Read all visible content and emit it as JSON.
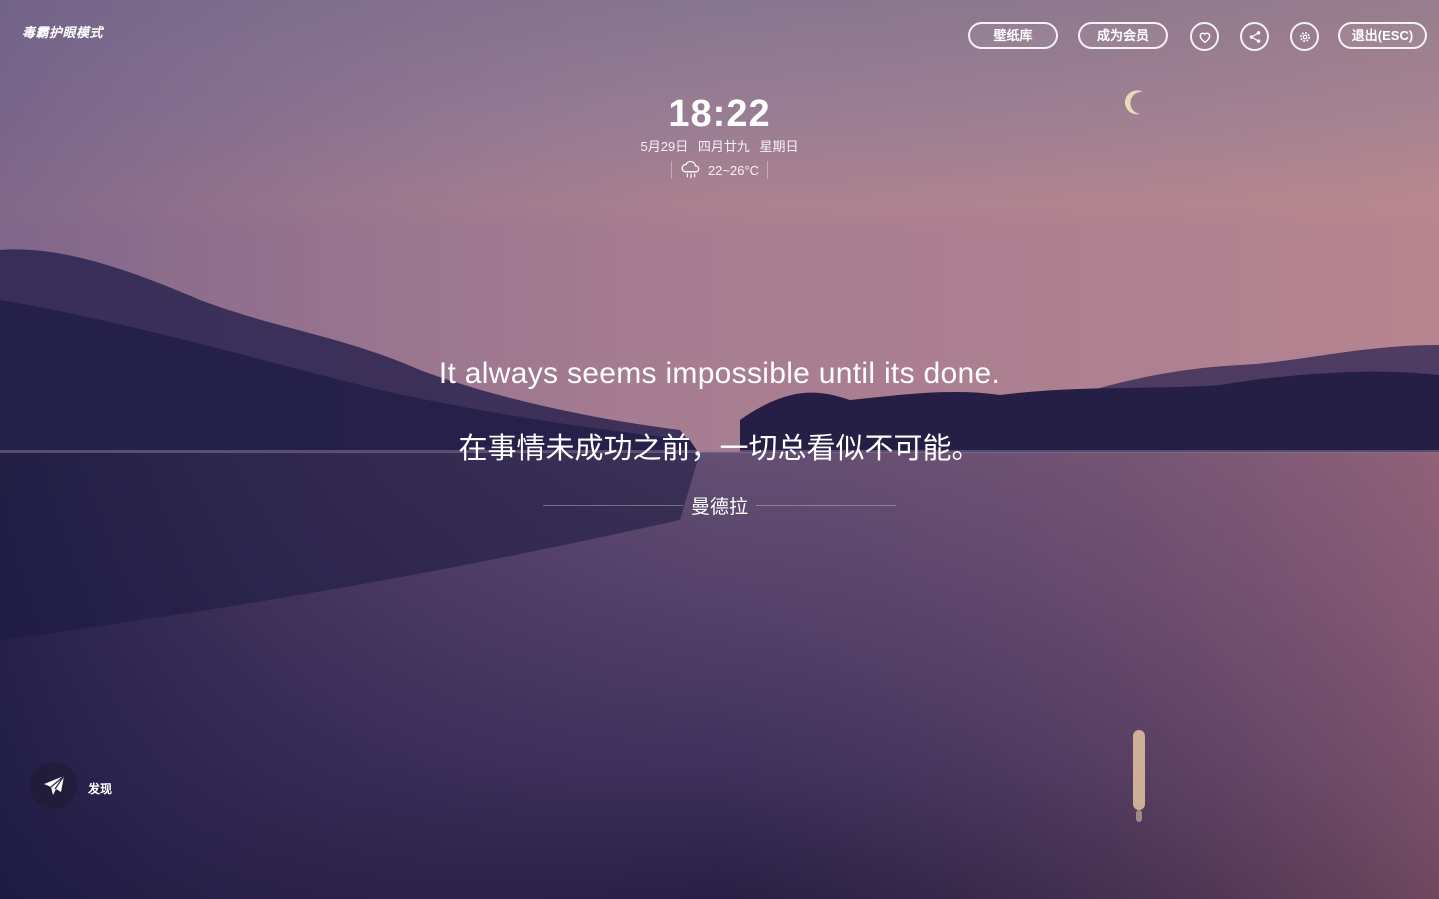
{
  "app": {
    "title": "毒霸护眼模式"
  },
  "toolbar": {
    "wallpaper_label": "壁纸库",
    "member_label": "成为会员",
    "favorite_icon": "heart-icon",
    "share_icon": "share-icon",
    "settings_icon": "gear-icon",
    "exit_label": "退出(ESC)"
  },
  "clock": {
    "time": "18:22",
    "date": "5月29日",
    "lunar": "四月廿九",
    "weekday": "星期日",
    "weather_icon": "rain-cloud-icon",
    "temperature": "22~26°C"
  },
  "quote": {
    "english": "It always seems impossible until its done.",
    "chinese": "在事情未成功之前，一切总看似不可能。",
    "author": "曼德拉"
  },
  "discover": {
    "icon": "paper-plane-icon",
    "label": "发现"
  },
  "colors": {
    "sky_top": "#8a7893",
    "sky_mid": "#b9868f",
    "water": "#3b2f5c"
  }
}
